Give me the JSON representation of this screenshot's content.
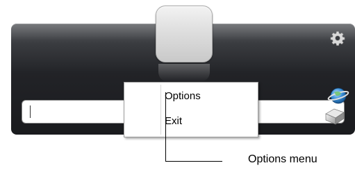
{
  "context_menu": {
    "items": [
      {
        "label": "Options"
      },
      {
        "label": "Exit"
      }
    ]
  },
  "annotation": {
    "label": "Options menu"
  },
  "search": {
    "value": ""
  },
  "icons": {
    "settings": "gear-icon",
    "send": "globe-icon"
  },
  "colors": {
    "panel_dark": "#1a1b1e",
    "panel_top": "#5b5d61",
    "menu_bg": "#ffffff",
    "menu_border": "#9a9a9a"
  }
}
